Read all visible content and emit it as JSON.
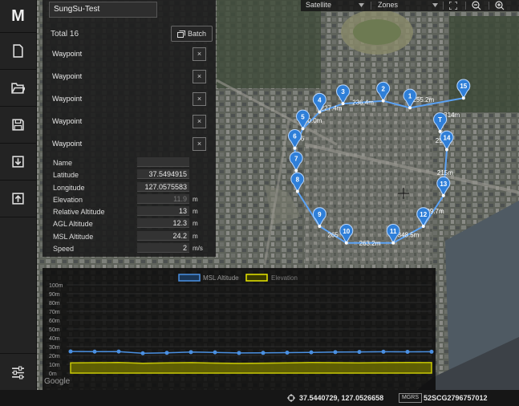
{
  "app": {
    "logo": "M"
  },
  "mission": {
    "name": "SungSu-Test",
    "total": "Total 16",
    "batch_label": "Batch"
  },
  "waypoint_list": [
    {
      "label": "Waypoint",
      "delete": "×"
    },
    {
      "label": "Waypoint",
      "delete": "×"
    },
    {
      "label": "Waypoint",
      "delete": "×"
    },
    {
      "label": "Waypoint",
      "delete": "×"
    },
    {
      "label": "Waypoint",
      "delete": "×"
    }
  ],
  "properties": [
    {
      "label": "Name",
      "value": "",
      "unit": ""
    },
    {
      "label": "Latitude",
      "value": "37.5494915",
      "unit": ""
    },
    {
      "label": "Longitude",
      "value": "127.0575583",
      "unit": ""
    },
    {
      "label": "Elevation",
      "value": "11.9",
      "unit": "m"
    },
    {
      "label": "Relative Altitude",
      "value": "13",
      "unit": "m"
    },
    {
      "label": "AGL Altitude",
      "value": "12.3",
      "unit": "m"
    },
    {
      "label": "MSL Altitude",
      "value": "24.2",
      "unit": "m"
    },
    {
      "label": "Speed",
      "value": "2",
      "unit": "m/s"
    }
  ],
  "map_toolbar": {
    "map_type": "Satellite",
    "zones": "Zones"
  },
  "route": {
    "points": [
      {
        "id": "1",
        "lat": 37.5475,
        "lon": 127.056
      },
      {
        "id": "2",
        "lat": 37.548,
        "lon": 127.052
      },
      {
        "id": "3",
        "lat": 37.5478,
        "lon": 127.046
      },
      {
        "id": "4",
        "lat": 37.5472,
        "lon": 127.0425
      },
      {
        "id": "5",
        "lat": 37.546,
        "lon": 127.04
      },
      {
        "id": "6",
        "lat": 37.5446,
        "lon": 127.0388
      },
      {
        "id": "7",
        "lat": 37.543,
        "lon": 127.039
      },
      {
        "id": "8",
        "lat": 37.5415,
        "lon": 127.0392
      },
      {
        "id": "9",
        "lat": 37.539,
        "lon": 127.0425
      },
      {
        "id": "10",
        "lat": 37.5378,
        "lon": 127.0465
      },
      {
        "id": "11",
        "lat": 37.5378,
        "lon": 127.0535
      },
      {
        "id": "12",
        "lat": 37.539,
        "lon": 127.058
      },
      {
        "id": "13",
        "lat": 37.5412,
        "lon": 127.061
      },
      {
        "id": "14",
        "lat": 37.5445,
        "lon": 127.0615
      },
      {
        "id": "T",
        "lat": 37.5458,
        "lon": 127.0605
      },
      {
        "id": "15",
        "lat": 37.5482,
        "lon": 127.064
      }
    ],
    "segments": [
      {
        "from": 4,
        "to": 3,
        "label": "200.0m"
      },
      {
        "from": 3,
        "to": 2,
        "label": "227.4m"
      },
      {
        "from": 2,
        "to": 1,
        "label": "236.4m"
      },
      {
        "from": 1,
        "to": 15,
        "label": "255.2m"
      },
      {
        "from": 15,
        "to": 14,
        "label": "314m"
      },
      {
        "from": 14,
        "to": 13,
        "label": "253m"
      },
      {
        "from": 13,
        "to": 12,
        "label": "215m"
      },
      {
        "from": 12,
        "to": 11,
        "label": "209.7m"
      },
      {
        "from": 11,
        "to": 10,
        "label": "348.5m"
      },
      {
        "from": 10,
        "to": 9,
        "label": "263.2m"
      },
      {
        "from": 9,
        "to": 8,
        "label": "265"
      },
      {
        "from": 5,
        "to": 4,
        "label": "186"
      }
    ]
  },
  "chart_data": {
    "type": "line",
    "legend": [
      "MSL Altitude",
      "Elevation"
    ],
    "y_ticks": [
      "100m",
      "90m",
      "80m",
      "70m",
      "60m",
      "50m",
      "40m",
      "30m",
      "20m",
      "10m",
      "0m"
    ],
    "ylim": [
      0,
      100
    ],
    "x": [
      1,
      2,
      3,
      4,
      5,
      6,
      7,
      8,
      9,
      10,
      11,
      12,
      13,
      14,
      15,
      16
    ],
    "series": [
      {
        "name": "MSL Altitude",
        "values": [
          24.5,
          24.3,
          24.4,
          22.5,
          23.0,
          23.8,
          23.5,
          22.8,
          22.9,
          23.2,
          23.5,
          23.8,
          24.0,
          24.2,
          24.1,
          24.2
        ]
      },
      {
        "name": "Elevation",
        "values": [
          11.5,
          11.8,
          12.0,
          11.2,
          11.5,
          11.9,
          11.4,
          11.0,
          11.3,
          11.6,
          12.0,
          11.8,
          11.5,
          11.9,
          12.1,
          11.9
        ]
      }
    ],
    "colors": {
      "msl": "#4a90e2",
      "elevation": "#e6e600"
    }
  },
  "status": {
    "coords": "37.5440729, 127.0526658",
    "mgrs_label": "MGRS",
    "mgrs_value": "52SCG2796757012"
  },
  "attribution": "Google"
}
